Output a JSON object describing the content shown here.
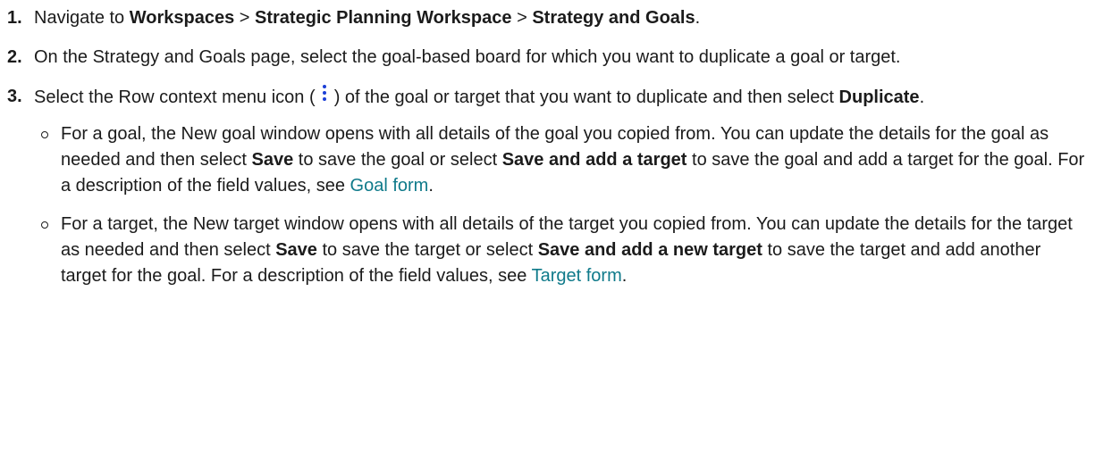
{
  "steps": [
    {
      "number": "1.",
      "t1": "Navigate to ",
      "b1": "Workspaces",
      "t2": " > ",
      "b2": "Strategic Planning Workspace",
      "t3": " > ",
      "b3": "Strategy and Goals",
      "t4": "."
    },
    {
      "number": "2.",
      "t1": "On the Strategy and Goals page, select the goal-based board for which you want to duplicate a goal or target."
    },
    {
      "number": "3.",
      "t1": "Select the Row context menu icon ( ",
      "icon": "row-context-menu-icon",
      "t2": " ) of the goal or target that you want to duplicate and then select ",
      "b1": "Duplicate",
      "t3": ".",
      "sub": [
        {
          "t1": "For a goal, the New goal window opens with all details of the goal you copied from. You can update the details for the goal as needed and then select ",
          "b1": "Save",
          "t2": " to save the goal or select ",
          "b2": "Save and add a target",
          "t3": " to save the goal and add a target for the goal. For a description of the field values, see ",
          "link": "Goal form",
          "t4": "."
        },
        {
          "t1": "For a target, the New target window opens with all details of the target you copied from. You can update the details for the target as needed and then select ",
          "b1": "Save",
          "t2": " to save the target or select ",
          "b2": "Save and add a new target",
          "t3": " to save the target and add another target for the goal. For a description of the field values, see ",
          "link": "Target form",
          "t4": "."
        }
      ]
    }
  ],
  "colors": {
    "text": "#1b1b1b",
    "link": "#0f7a8a",
    "icon": "#1c3fd6"
  }
}
